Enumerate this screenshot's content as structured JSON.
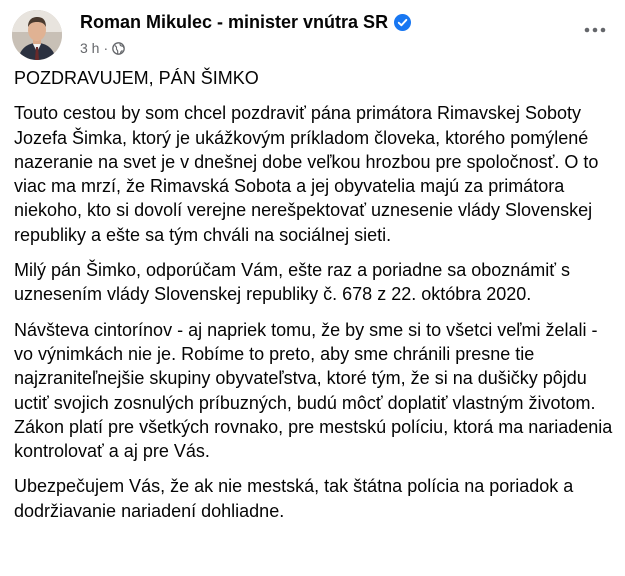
{
  "post": {
    "author": "Roman Mikulec - minister vnútra SR",
    "time": "3 h",
    "separator": "·",
    "title": "POZDRAVUJEM, PÁN ŠIMKO",
    "paragraphs": [
      "Touto cestou by som chcel pozdraviť pána primátora Rimavskej Soboty Jozefa Šimka, ktorý je ukážkovým príkladom človeka, ktorého pomýlené nazeranie na svet je v dnešnej dobe veľkou hrozbou pre spoločnosť. O to viac ma mrzí, že Rimavská Sobota a jej obyvatelia majú za primátora niekoho, kto si dovolí verejne nerešpektovať uznesenie vlády Slovenskej republiky a ešte sa tým chváli na sociálnej sieti.",
      "Milý pán Šimko, odporúčam Vám, ešte raz a poriadne sa oboznámiť s uznesením vlády Slovenskej republiky č. 678 z 22. októbra 2020.",
      "Návšteva cintorínov - aj napriek tomu, že by sme si to všetci veľmi želali - vo výnimkách nie je. Robíme to preto, aby sme chránili presne tie najzraniteľnejšie skupiny obyvateľstva, ktoré tým, že si na dušičky pôjdu uctiť svojich zosnulých príbuzných, budú môcť doplatiť vlastným životom. Zákon platí pre všetkých rovnako, pre mestskú políciu, ktorá ma nariadenia kontrolovať a aj pre Vás.",
      "Ubezpečujem Vás, že ak nie mestská, tak štátna polícia na poriadok a dodržiavanie nariadení dohliadne."
    ]
  },
  "icons": {
    "verified": "verified-badge-icon",
    "audience": "globe-icon",
    "more": "more-dots-icon"
  },
  "colors": {
    "verified_blue": "#1877f2",
    "meta_gray": "#65676b",
    "text": "#050505"
  }
}
